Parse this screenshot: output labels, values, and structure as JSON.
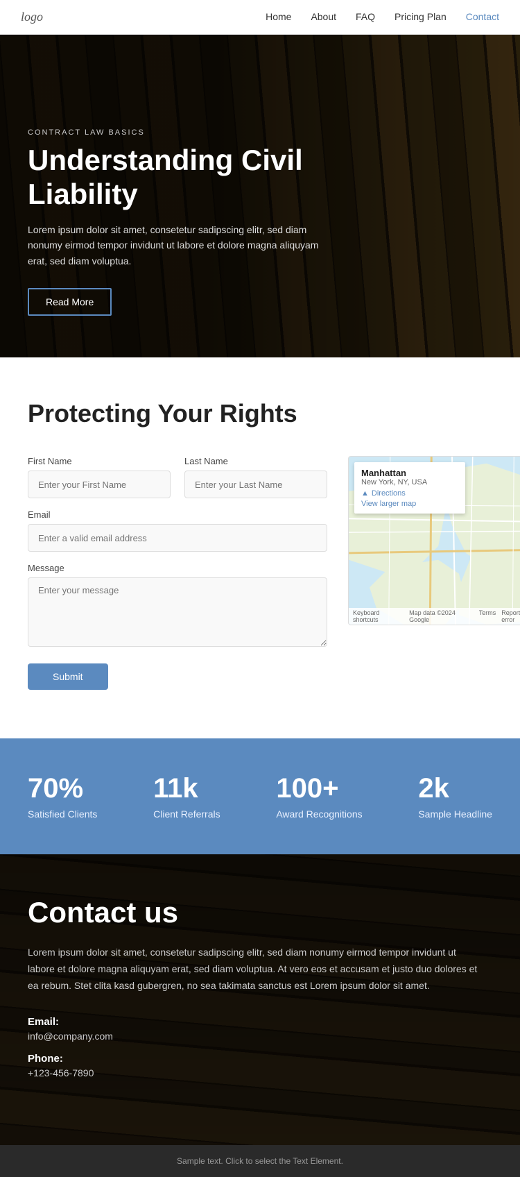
{
  "nav": {
    "logo": "logo",
    "links": [
      {
        "label": "Home",
        "active": false
      },
      {
        "label": "About",
        "active": false
      },
      {
        "label": "FAQ",
        "active": false
      },
      {
        "label": "Pricing Plan",
        "active": false
      },
      {
        "label": "Contact",
        "active": true
      }
    ]
  },
  "hero": {
    "tag": "CONTRACT LAW BASICS",
    "title": "Understanding Civil Liability",
    "description": "Lorem ipsum dolor sit amet, consetetur sadipscing elitr, sed diam nonumy eirmod tempor invidunt ut labore et dolore magna aliquyam erat, sed diam voluptua.",
    "cta_label": "Read More"
  },
  "form_section": {
    "title": "Protecting Your Rights",
    "first_name_label": "First Name",
    "first_name_placeholder": "Enter your First Name",
    "last_name_label": "Last Name",
    "last_name_placeholder": "Enter your Last Name",
    "email_label": "Email",
    "email_placeholder": "Enter a valid email address",
    "message_label": "Message",
    "message_placeholder": "Enter your message",
    "submit_label": "Submit"
  },
  "map": {
    "place_name": "Manhattan",
    "place_address": "New York, NY, USA",
    "directions_label": "Directions",
    "view_larger_label": "View larger map",
    "zoom_in": "+",
    "zoom_out": "−",
    "footer_keyboard": "Keyboard shortcuts",
    "footer_map_data": "Map data ©2024 Google",
    "footer_terms": "Terms",
    "footer_report": "Report a map error"
  },
  "stats": [
    {
      "number": "70%",
      "label": "Satisfied Clients"
    },
    {
      "number": "11k",
      "label": "Client Referrals"
    },
    {
      "number": "100+",
      "label": "Award Recognitions"
    },
    {
      "number": "2k",
      "label": "Sample Headline"
    }
  ],
  "contact_us": {
    "title": "Contact us",
    "description": "Lorem ipsum dolor sit amet, consetetur sadipscing elitr, sed diam nonumy eirmod tempor invidunt ut labore et dolore magna aliquyam erat, sed diam voluptua. At vero eos et accusam et justo duo dolores et ea rebum. Stet clita kasd gubergren, no sea takimata sanctus est Lorem ipsum dolor sit amet.",
    "email_label": "Email:",
    "email_value": "info@company.com",
    "phone_label": "Phone:",
    "phone_value": "+123-456-7890"
  },
  "footer": {
    "text": "Sample text. Click to select the Text Element."
  }
}
